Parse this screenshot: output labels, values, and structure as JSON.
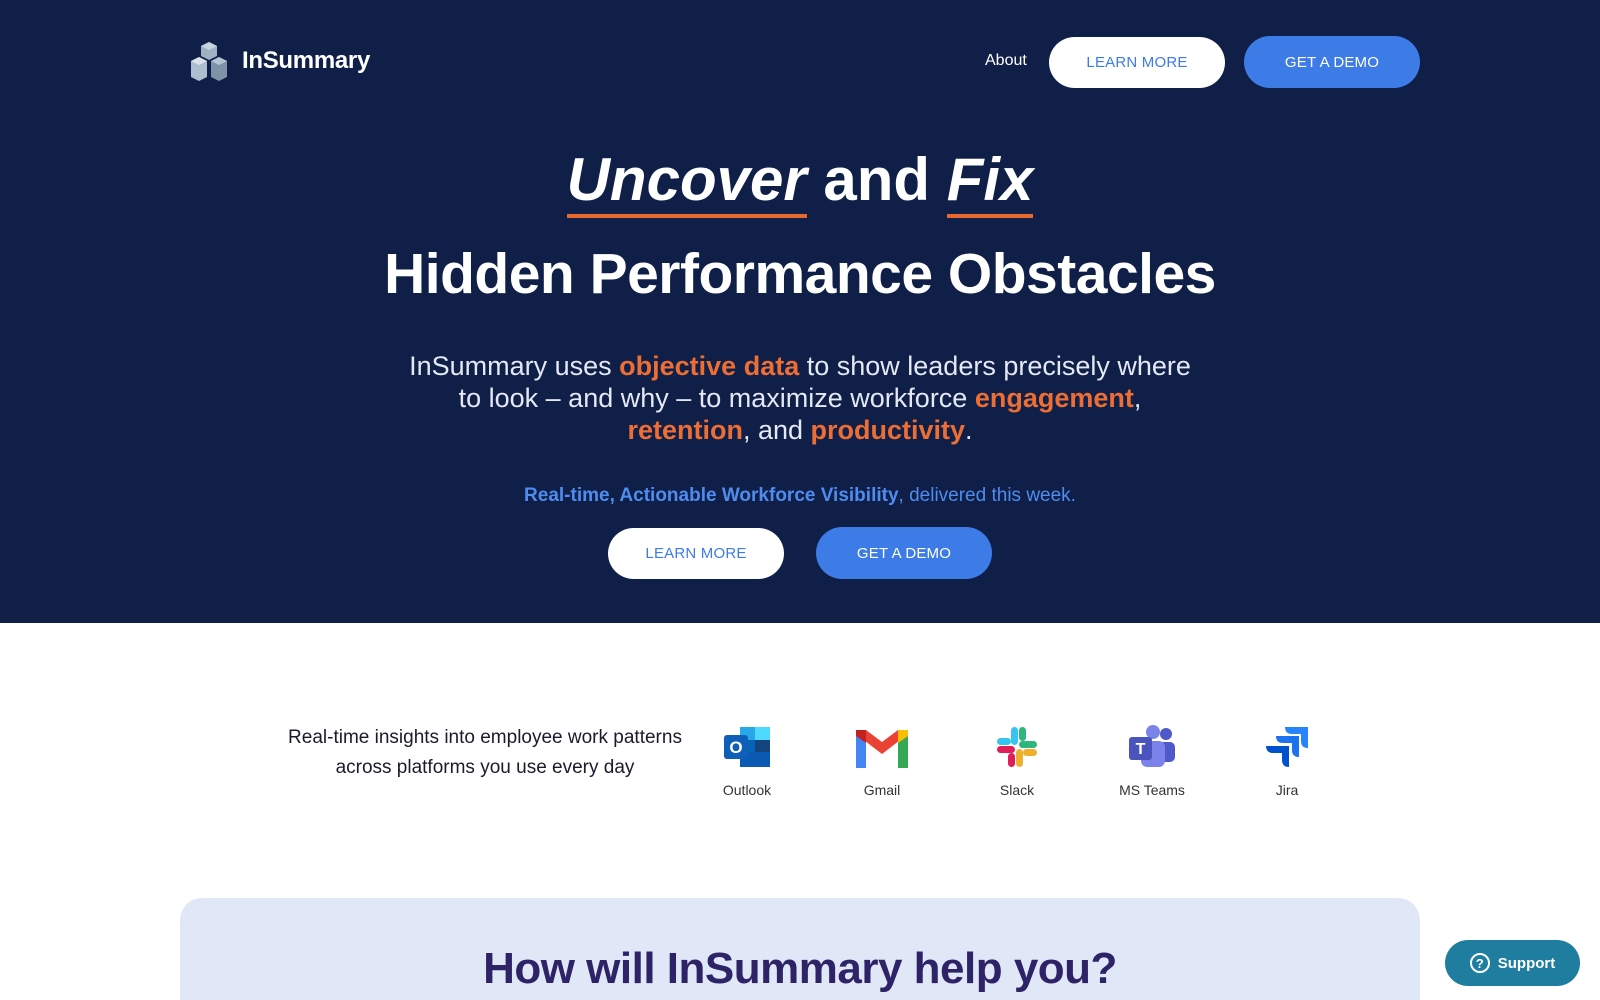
{
  "brand": {
    "name": "InSummary"
  },
  "nav": {
    "about": "About",
    "learn_more": "LEARN MORE",
    "get_demo": "GET A DEMO"
  },
  "hero": {
    "word1": "Uncover",
    "and": " and ",
    "word2": "Fix",
    "line2": "Hidden Performance Obstacles",
    "sub": {
      "t1": "InSummary uses ",
      "h1": "objective data",
      "t2": " to show leaders precisely where to look – and why – to maximize workforce ",
      "h2": "engagement",
      "t3": ", ",
      "h3": "retention",
      "t4": ", and ",
      "h4": "productivity",
      "t5": "."
    },
    "tagline_bold": "Real-time, Actionable Workforce Visibility",
    "tagline_rest": ", delivered this week.",
    "learn_more": "LEARN MORE",
    "get_demo": "GET A DEMO"
  },
  "integrations": {
    "text": "Real-time insights into employee work patterns across platforms you use every day",
    "items": [
      {
        "label": "Outlook",
        "icon": "outlook-icon"
      },
      {
        "label": "Gmail",
        "icon": "gmail-icon"
      },
      {
        "label": "Slack",
        "icon": "slack-icon"
      },
      {
        "label": "MS Teams",
        "icon": "ms-teams-icon"
      },
      {
        "label": "Jira",
        "icon": "jira-icon"
      }
    ]
  },
  "help": {
    "title": "How will InSummary help you?"
  },
  "support": {
    "label": "Support"
  },
  "colors": {
    "hero_bg": "#0f1f47",
    "accent_orange": "#ec6e35",
    "accent_blue": "#3d7be6",
    "card_bg": "#e0e8f8",
    "help_title": "#2d2366",
    "support_bg": "#1f7da0"
  }
}
